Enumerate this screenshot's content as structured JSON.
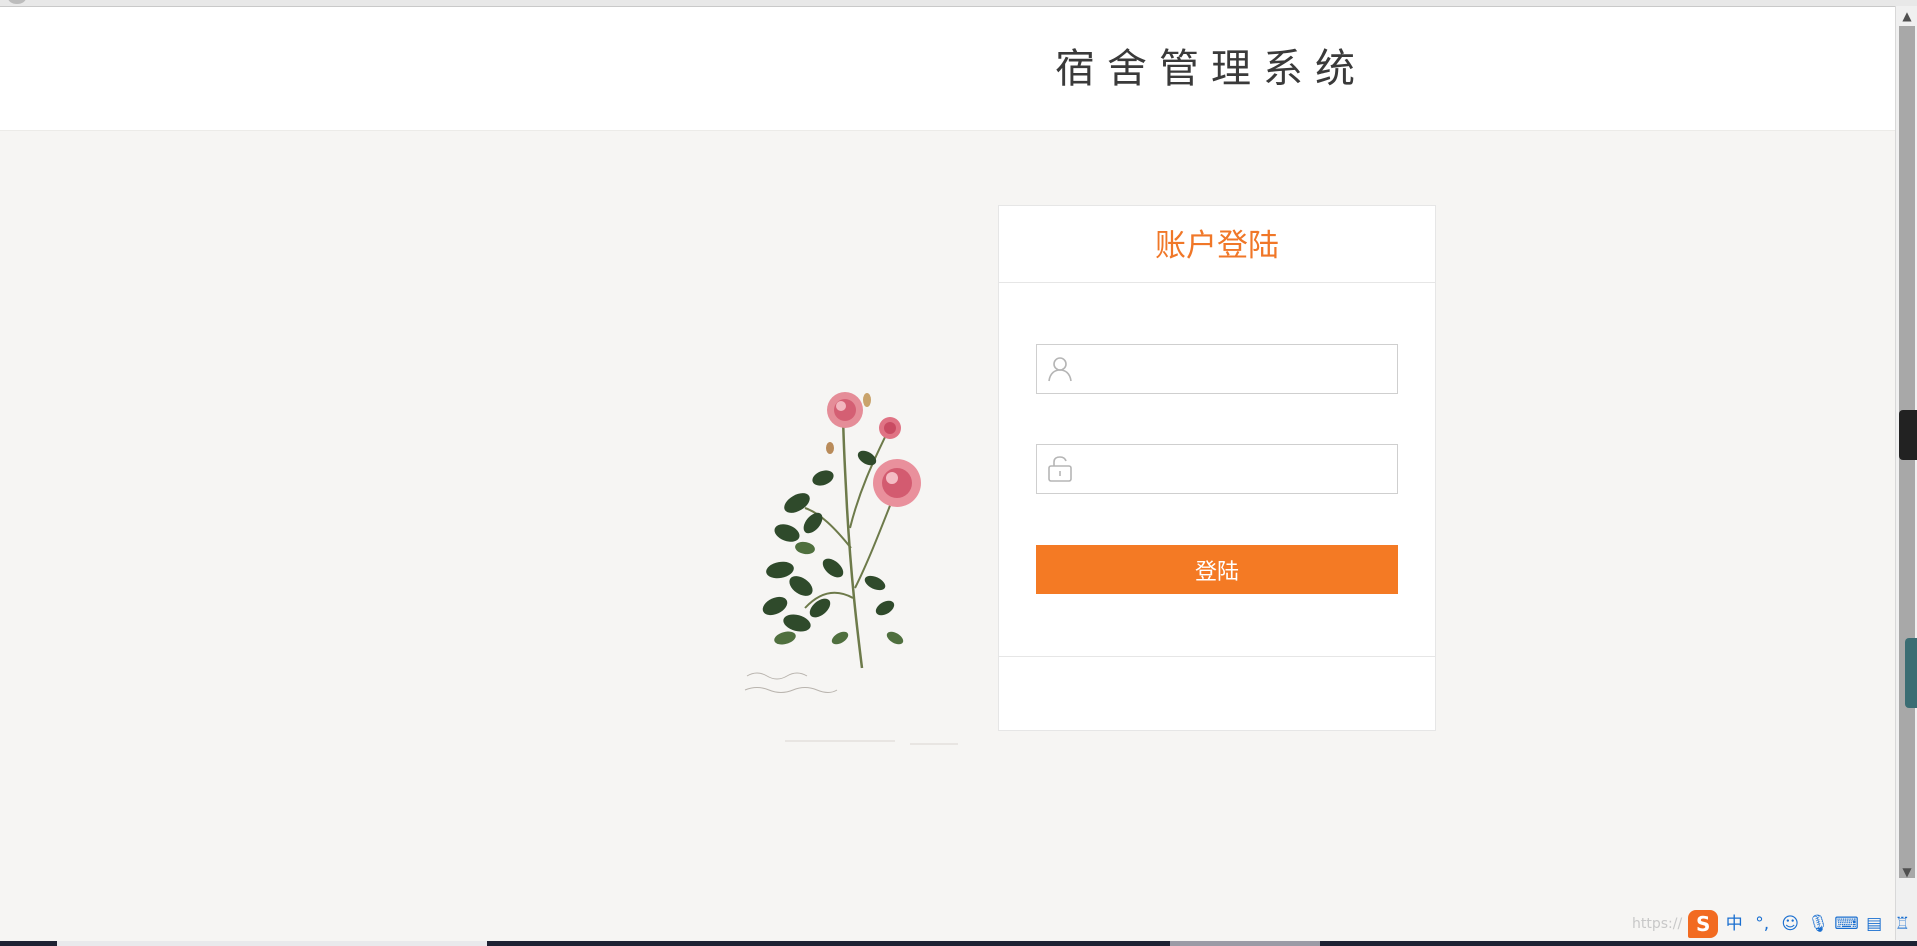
{
  "header": {
    "title": "宿舍管理系统"
  },
  "login": {
    "title": "账户登陆",
    "username": {
      "value": "",
      "placeholder": ""
    },
    "password": {
      "value": "",
      "placeholder": ""
    },
    "submit_label": "登陆"
  },
  "ime": {
    "watermark": "https://",
    "logo": "S",
    "mode": "中",
    "punct": "°,",
    "icons": [
      "emoji-icon",
      "microphone-icon",
      "keyboard-icon",
      "toolbox-icon",
      "shirt-icon",
      "grid-icon"
    ]
  },
  "colors": {
    "accent": "#f47a24",
    "title_accent": "#f07728",
    "background": "#f6f5f3"
  }
}
